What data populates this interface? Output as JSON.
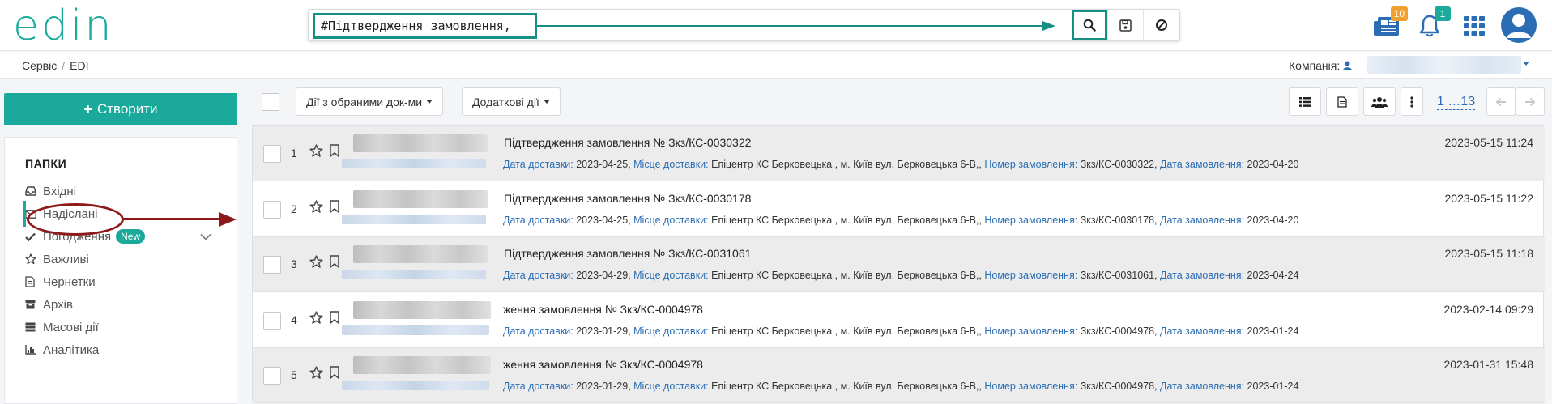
{
  "header": {
    "logo": "edin",
    "search_value": "#Підтвердження замовлення,",
    "messages_badge": "10",
    "notifications_badge": "1"
  },
  "breadcrumb": {
    "items": [
      "Сервіс",
      "EDI"
    ],
    "company_label": "Компанія:"
  },
  "sidebar": {
    "create_label": "Створити",
    "folders_title": "ПАПКИ",
    "items": [
      {
        "label": "Вхідні",
        "icon": "inbox-icon"
      },
      {
        "label": "Надіслані",
        "icon": "envelope-icon"
      },
      {
        "label": "Погодження",
        "icon": "check-icon",
        "badge": "New"
      },
      {
        "label": "Важливі",
        "icon": "star-icon"
      },
      {
        "label": "Чернетки",
        "icon": "document-icon"
      },
      {
        "label": "Архів",
        "icon": "archive-icon"
      },
      {
        "label": "Масові дії",
        "icon": "bulk-actions-icon"
      },
      {
        "label": "Аналітика",
        "icon": "analytics-icon"
      }
    ]
  },
  "toolbar": {
    "bulk_actions_label": "Дії з обраними док-ми",
    "extra_actions_label": "Додаткові дії",
    "pager": "1 …13"
  },
  "rows": [
    {
      "num": "1",
      "title": "Підтвердження замовлення № Зкз/КС-0030322",
      "delivery_date": "2023-04-25",
      "place": "Епіцентр КС Берковецька , м. Київ вул. Берковецька 6-В,",
      "order_num": "Зкз/КС-0030322",
      "order_date": "2023-04-20",
      "date": "2023-05-15 11:24",
      "shaded": true,
      "truncated": false
    },
    {
      "num": "2",
      "title": "Підтвердження замовлення № Зкз/КС-0030178",
      "delivery_date": "2023-04-25",
      "place": "Епіцентр КС Берковецька , м. Київ вул. Берковецька 6-В,",
      "order_num": "Зкз/КС-0030178",
      "order_date": "2023-04-20",
      "date": "2023-05-15 11:22",
      "shaded": false,
      "truncated": false
    },
    {
      "num": "3",
      "title": "Підтвердження замовлення № Зкз/КС-0031061",
      "delivery_date": "2023-04-29",
      "place": "Епіцентр КС Берковецька , м. Київ вул. Берковецька 6-В,",
      "order_num": "Зкз/КС-0031061",
      "order_date": "2023-04-24",
      "date": "2023-05-15 11:18",
      "shaded": true,
      "truncated": false
    },
    {
      "num": "4",
      "title": "ження замовлення № Зкз/КС-0004978",
      "delivery_date": "2023-01-29",
      "place": "Епіцентр КС Берковецька , м. Київ вул. Берковецька 6-В,",
      "order_num": "Зкз/КС-0004978",
      "order_date": "2023-01-24",
      "date": "2023-02-14 09:29",
      "shaded": false,
      "truncated": true
    },
    {
      "num": "5",
      "title": "ження замовлення № Зкз/КС-0004978",
      "delivery_date": "2023-01-29",
      "place": "Епіцентр КС Берковецька , м. Київ вул. Берковецька 6-В,",
      "order_num": "Зкз/КС-0004978",
      "order_date": "2023-01-24",
      "date": "2023-01-31 15:48",
      "shaded": true,
      "truncated": true
    }
  ],
  "meta_labels": {
    "delivery_date": "Дата доставки:",
    "place": "Місце доставки:",
    "order_num": "Номер замовлення:",
    "order_date": "Дата замовлення:"
  },
  "colors": {
    "brand": "#1aa99a",
    "highlight": "#168f85",
    "annotation": "#8c1a1a",
    "link": "#2a6db5"
  }
}
